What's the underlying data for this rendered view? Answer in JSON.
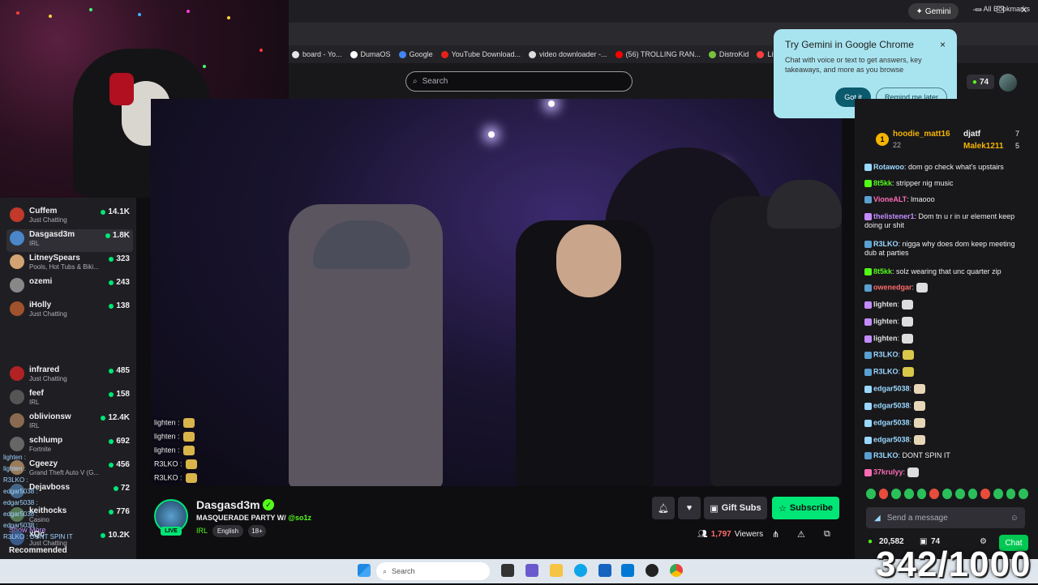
{
  "browser": {
    "gemini_pill": "Gemini",
    "bookmarks": [
      {
        "label": "board - Yo...",
        "color": "#e5e5e5"
      },
      {
        "label": "DumaOS",
        "color": "#ffffff"
      },
      {
        "label": "Google",
        "color": "#4285f4"
      },
      {
        "label": "YouTube Download...",
        "color": "#e62117"
      },
      {
        "label": "video downloader -...",
        "color": "#dddddd"
      },
      {
        "label": "(56) TROLLING RAN...",
        "color": "#ff0000"
      },
      {
        "label": "DistroKid",
        "color": "#78c23d"
      },
      {
        "label": "Live Dashboard",
        "color": "#ff3d3d"
      }
    ],
    "all_bookmarks": "All Bookmarks"
  },
  "gemini_popup": {
    "title": "Try Gemini in Google Chrome",
    "body": "Chat with voice or text to get answers, key takeaways, and more as you browse",
    "close": "×",
    "got_it": "Got it",
    "remind_later": "Remind me later"
  },
  "nav": {
    "search_placeholder": "Search",
    "points": "74"
  },
  "sidebar": {
    "followed": [
      {
        "name": "Cuffem",
        "game": "Just Chatting",
        "viewers": "14.1K",
        "color": "#c0392b"
      },
      {
        "name": "Dasgasd3m",
        "game": "IRL",
        "viewers": "1.8K",
        "color": "#4a86c8"
      },
      {
        "name": "LitneySpears",
        "game": "Pools, Hot Tubs & Biki...",
        "viewers": "323",
        "color": "#d4a373"
      },
      {
        "name": "ozemi",
        "game": "",
        "viewers": "243",
        "color": "#888888"
      },
      {
        "name": "iHolly",
        "game": "Just Chatting",
        "viewers": "138",
        "color": "#a0522d"
      }
    ],
    "show_more": "Show More",
    "recommended_title": "Recommended",
    "recommended": [
      {
        "name": "infrared",
        "game": "Just Chatting",
        "viewers": "485",
        "color": "#b22222"
      },
      {
        "name": "feef",
        "game": "IRL",
        "viewers": "158",
        "color": "#555555"
      },
      {
        "name": "oblivionsw",
        "game": "IRL",
        "viewers": "12.4K",
        "color": "#8a6a50"
      },
      {
        "name": "schlump",
        "game": "Fortnite",
        "viewers": "692",
        "color": "#666666"
      },
      {
        "name": "Cgeezy",
        "game": "Grand Theft Auto V (G...",
        "viewers": "456",
        "color": "#9a7b5a"
      },
      {
        "name": "Dejavboss",
        "game": "",
        "viewers": "72",
        "color": "#446688"
      },
      {
        "name": "keithocks",
        "game": "Casino",
        "viewers": "776",
        "color": "#557755"
      },
      {
        "name": "xQc",
        "game": "Just Chatting",
        "viewers": "10.2K",
        "color": "#3a5a8a"
      }
    ],
    "ghost_chat": [
      "lighten :",
      "lighten :",
      "R3LKO :",
      "edgar5038 :",
      "edgar5038 :",
      "edgar5038 :",
      "edgar5038 :",
      "R3LKO : DONT SPIN IT"
    ]
  },
  "video_chat": [
    "lighten :",
    "lighten :",
    "lighten :",
    "R3LKO :",
    "R3LKO :"
  ],
  "leaderboard": {
    "rank": "1",
    "first_user": "hoodie_matt16",
    "first_count": "22",
    "second_user": "djatf",
    "second_count": "7",
    "third_user": "Malek1211",
    "third_count": "5"
  },
  "chat": [
    {
      "user": "Rotawoo",
      "msg": ": dom go check what's upstairs",
      "color": "#9ad8ff"
    },
    {
      "user": "8t5kk",
      "msg": ": stripper nig music",
      "color": "#53fc18"
    },
    {
      "user": "VioneALT",
      "msg": ": lmaooo",
      "color": "#ff6bb5"
    },
    {
      "user": "thelistener1",
      "msg": ": Dom tn u r in ur element keep doing ur shit",
      "color": "#c48bff"
    },
    {
      "user": "R3LKO",
      "msg": ": nigga why does dom keep meeting dub at parties",
      "color": "#9ad8ff"
    },
    {
      "user": "8t5kk",
      "msg": ": solz wearing that unc quarter zip",
      "color": "#53fc18"
    },
    {
      "user": "owenedgar",
      "msg": ":",
      "color": "#ff6b6b"
    },
    {
      "user": "lighten",
      "msg": ":",
      "color": "#e0e0e0"
    },
    {
      "user": "lighten",
      "msg": ":",
      "color": "#e0e0e0"
    },
    {
      "user": "lighten",
      "msg": ":",
      "color": "#e0e0e0"
    },
    {
      "user": "R3LKO",
      "msg": ":",
      "color": "#9ad8ff"
    },
    {
      "user": "R3LKO",
      "msg": ":",
      "color": "#9ad8ff"
    },
    {
      "user": "edgar5038",
      "msg": ":",
      "color": "#9ad8ff"
    },
    {
      "user": "edgar5038",
      "msg": ":",
      "color": "#9ad8ff"
    },
    {
      "user": "edgar5038",
      "msg": ":",
      "color": "#9ad8ff"
    },
    {
      "user": "edgar5038",
      "msg": ":",
      "color": "#9ad8ff"
    },
    {
      "user": "R3LKO",
      "msg": ": DONT SPIN IT",
      "color": "#9ad8ff"
    },
    {
      "user": "37krulyy",
      "msg": ":",
      "color": "#ff6bb5"
    }
  ],
  "chat_input_placeholder": "Send a message",
  "chat_footer": {
    "points": "20,582",
    "subs": "74",
    "chat_button": "Chat"
  },
  "stream": {
    "name": "Dasgasd3m",
    "title": "MASQUERADE PARTY W/ ",
    "collab": "@so1z",
    "category": "IRL",
    "language": "English",
    "rating": "18+",
    "viewers": "1,797",
    "viewers_label": "Viewers",
    "live": "LIVE",
    "gift_subs": "Gift Subs",
    "subscribe": "Subscribe"
  },
  "taskbar": {
    "search": "Search"
  },
  "counter": "342/1000",
  "colors": {
    "kick_green": "#53fc18",
    "subscribe_green": "#00e676",
    "bg": "#0e0e10"
  }
}
